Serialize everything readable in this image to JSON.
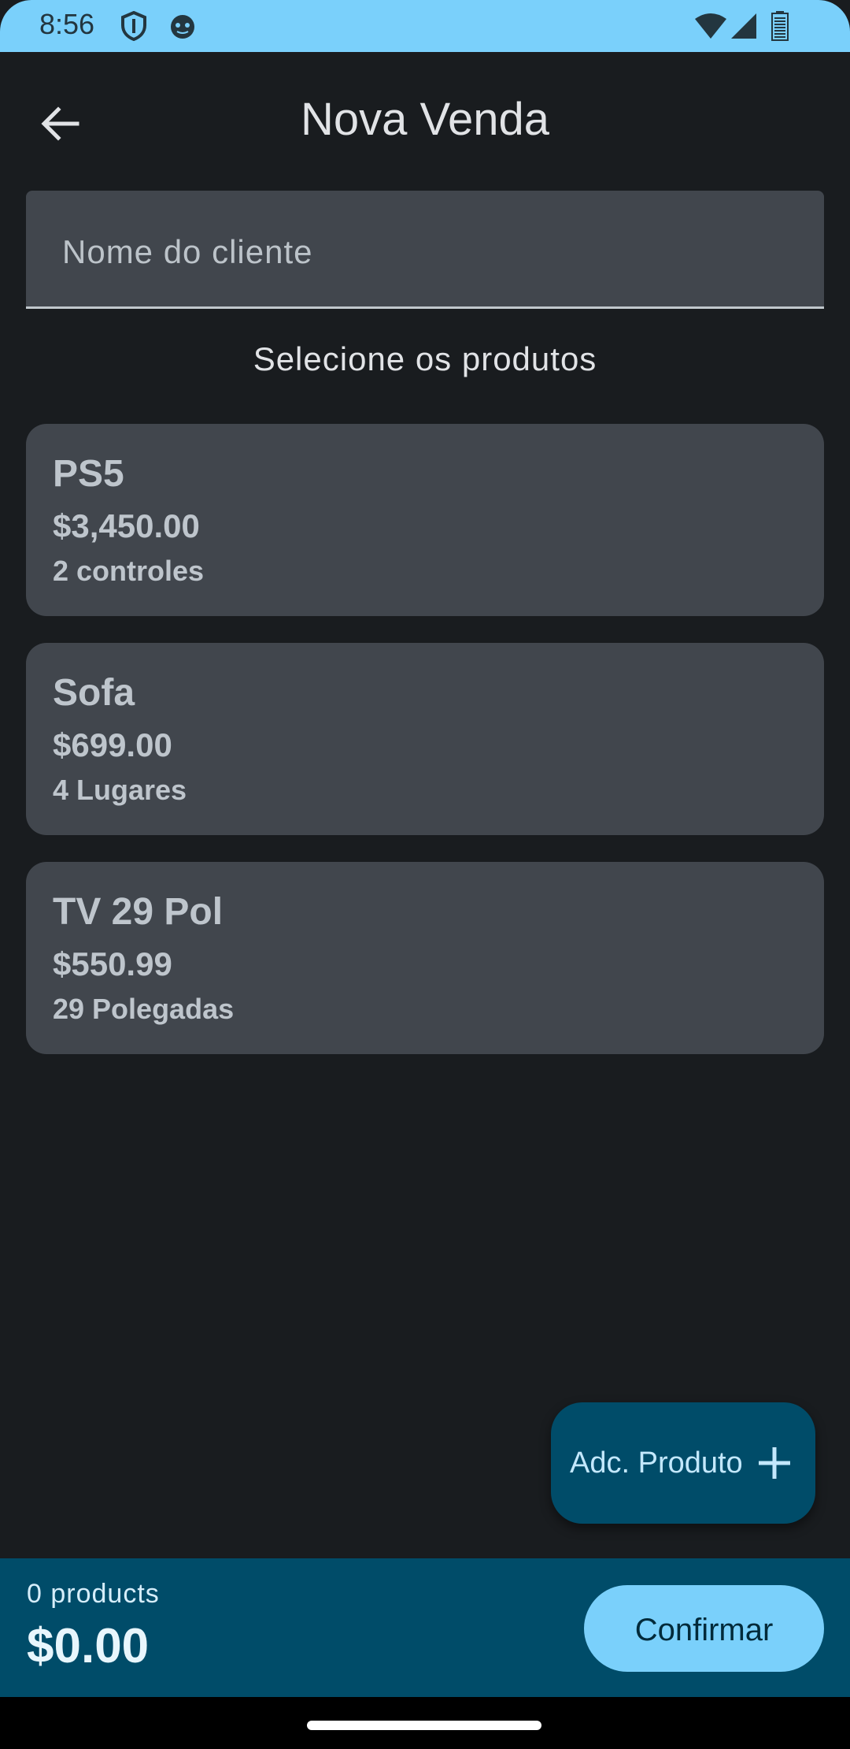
{
  "status_bar": {
    "time": "8:56",
    "icons": [
      "shield-icon",
      "face-icon",
      "wifi-icon",
      "signal-icon",
      "battery-icon"
    ]
  },
  "app_bar": {
    "title": "Nova Venda",
    "back_icon": "arrow-back-icon"
  },
  "client_field": {
    "placeholder": "Nome do cliente",
    "value": ""
  },
  "section_label": "Selecione os produtos",
  "products": [
    {
      "name": "PS5",
      "price": "$3,450.00",
      "description": "2 controles"
    },
    {
      "name": "Sofa",
      "price": "$699.00",
      "description": "4 Lugares"
    },
    {
      "name": "TV 29 Pol",
      "price": "$550.99",
      "description": "29 Polegadas"
    }
  ],
  "fab": {
    "label": "Adc. Produto",
    "icon": "plus-icon"
  },
  "footer": {
    "count_label": "0 products",
    "total": "$0.00",
    "confirm_label": "Confirmar"
  },
  "colors": {
    "background": "#191c1f",
    "card": "#41464d",
    "primary_container": "#004c69",
    "primary": "#7ad0fb"
  }
}
